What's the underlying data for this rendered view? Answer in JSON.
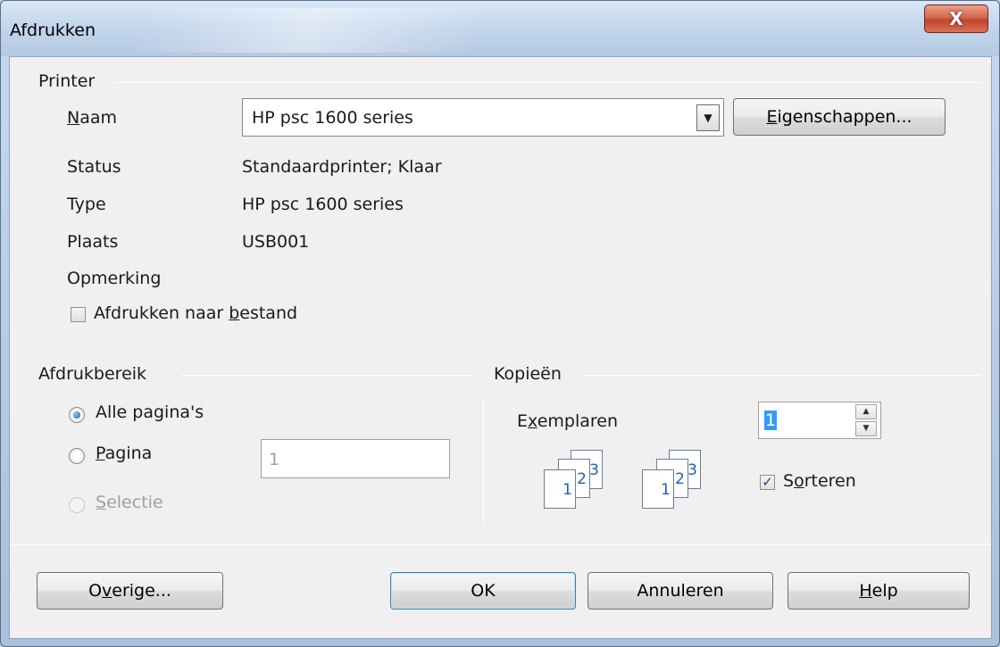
{
  "window": {
    "title": "Afdrukken",
    "close_label": "X"
  },
  "printer": {
    "section_label": "Printer",
    "name_label": "Naam",
    "name_value": "HP psc 1600 series",
    "properties_button": "Eigenschappen...",
    "status_label": "Status",
    "status_value": "Standaardprinter; Klaar",
    "type_label": "Type",
    "type_value": "HP psc 1600 series",
    "location_label": "Plaats",
    "location_value": "USB001",
    "comment_label": "Opmerking",
    "print_to_file_label": "Afdrukken naar bestand",
    "print_to_file_checked": false
  },
  "range": {
    "section_label": "Afdrukbereik",
    "all_pages_label": "Alle pagina's",
    "pages_label": "Pagina",
    "pages_value": "1",
    "selection_label": "Selectie",
    "selected": "all"
  },
  "copies": {
    "section_label": "Kopieën",
    "copies_label": "Exemplaren",
    "copies_value": "1",
    "collate_label": "Sorteren",
    "collate_checked": true,
    "pages": [
      "1",
      "2",
      "3"
    ]
  },
  "buttons": {
    "other": "Overige...",
    "ok": "OK",
    "cancel": "Annuleren",
    "help": "Help"
  }
}
